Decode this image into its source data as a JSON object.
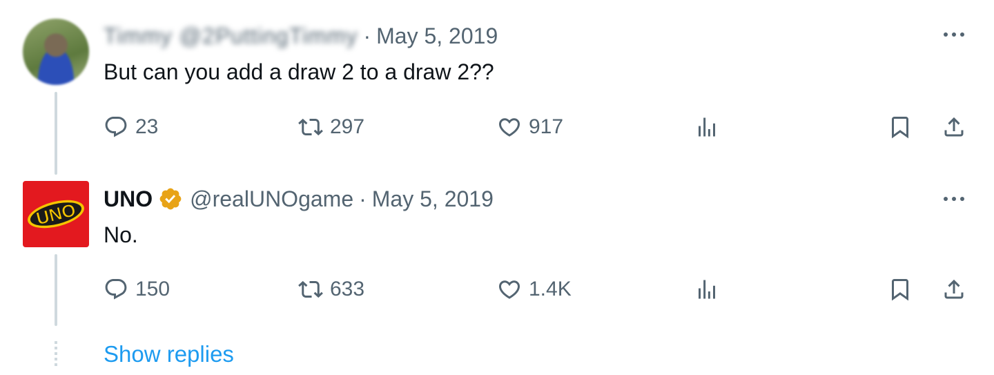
{
  "tweets": [
    {
      "display_name": "Timmy",
      "handle": "@2PuttingTimmy",
      "separator": "·",
      "date": "May 5, 2019",
      "text": "But can you add a draw 2 to a draw 2??",
      "replies": "23",
      "retweets": "297",
      "likes": "917",
      "name_blurred": true,
      "avatar_icon": "user-avatar"
    },
    {
      "display_name": "UNO",
      "handle": "@realUNOgame",
      "separator": "·",
      "date": "May 5, 2019",
      "text": "No.",
      "replies": "150",
      "retweets": "633",
      "likes": "1.4K",
      "verified": true,
      "avatar_icon": "uno-logo",
      "logo_text": "UNO"
    }
  ],
  "show_replies_label": "Show replies",
  "colors": {
    "text": "#0f1419",
    "muted": "#536471",
    "link": "#1d9bf0",
    "verified_gold": "#e8a317",
    "uno_red": "#e3191f",
    "thread_line": "#cfd9de"
  },
  "icons": [
    "reply-icon",
    "retweet-icon",
    "like-icon",
    "views-icon",
    "bookmark-icon",
    "share-icon",
    "more-icon",
    "verified-badge-icon"
  ]
}
